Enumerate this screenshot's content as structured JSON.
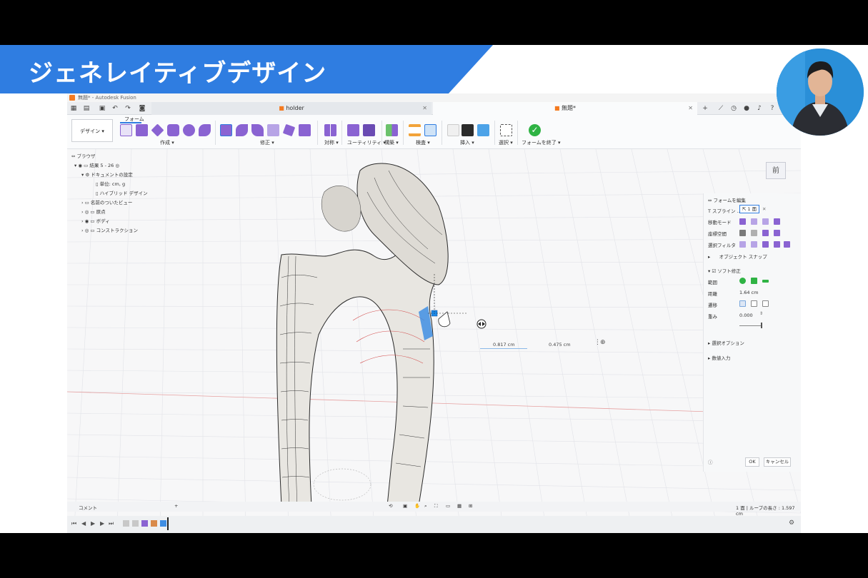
{
  "banner": {
    "title": "ジェネレイティブデザイン"
  },
  "window": {
    "title": "無題* - Autodesk Fusion"
  },
  "tabs": [
    {
      "label": "holder"
    },
    {
      "label": "無題*"
    }
  ],
  "ribbon": {
    "tab": "フォーム",
    "design_button": "デザイン ▾",
    "groups": {
      "create": "作成 ▾",
      "modify": "修正 ▾",
      "symmetry": "対称 ▾",
      "utility": "ユーティリティ ▾",
      "construct": "構築 ▾",
      "inspect": "検査 ▾",
      "insert": "挿入 ▾",
      "select": "選択 ▾",
      "finish": "フォームを終了 ▾"
    }
  },
  "browser": {
    "header": "ブラウザ",
    "root": "結果 5 - 26",
    "items": [
      {
        "label": "ドキュメントの設定"
      },
      {
        "label": "単位: cm, g"
      },
      {
        "label": "ハイブリッド デザイン"
      },
      {
        "label": "名前のついたビュー"
      },
      {
        "label": "原点"
      },
      {
        "label": "ボディ"
      },
      {
        "label": "コンストラクション"
      }
    ]
  },
  "viewcube": {
    "face": "前"
  },
  "edit_form": {
    "title": "フォームを編集",
    "t_spline": "T スプライン ...",
    "selection": "1 面",
    "move_mode": "移動モード",
    "coordinate_space": "座標空間",
    "selection_filter": "選択フィルタ",
    "object_snap": "オブジェクト スナップ",
    "soft_modify": "ソフト修正",
    "range": "範囲",
    "distance_label": "距離",
    "distance_value": "1.64 cm",
    "transition": "遷移",
    "weight_label": "重み",
    "weight_value": "0.000",
    "selection_options": "選択オプション",
    "numeric_input": "数値入力",
    "ok": "OK",
    "cancel": "キャンセル"
  },
  "measure": {
    "value1": "0.817 cm",
    "value2": "0.475 cm"
  },
  "status": {
    "comment": "コメント",
    "info": "1 面 | ループの長さ : 1.597 cm"
  },
  "colors": {
    "banner": "#2f7de1",
    "accent": "#2f7de1",
    "finish_green": "#2fb344",
    "form_purple": "#8a63d2"
  }
}
